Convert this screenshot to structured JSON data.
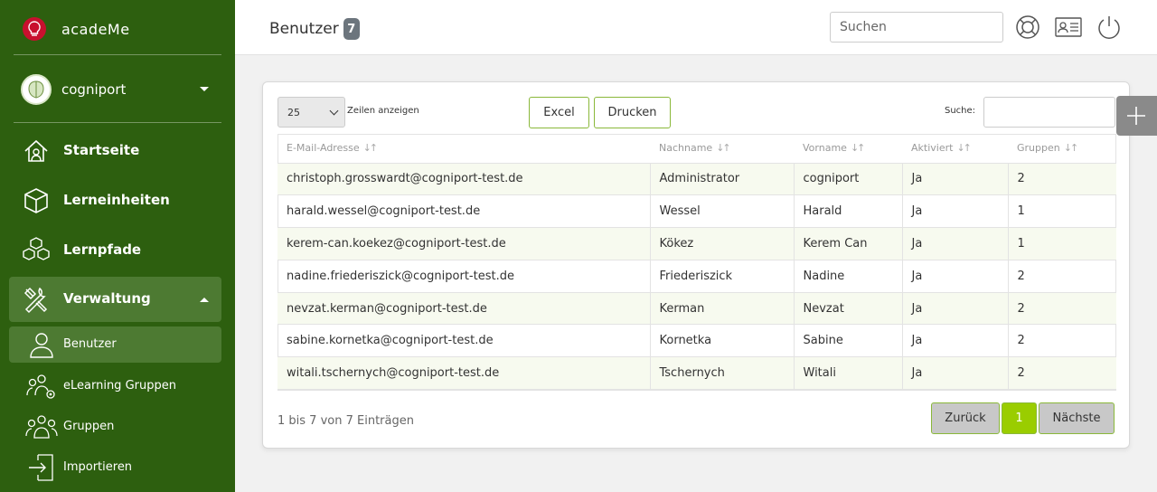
{
  "app": {
    "name": "acadeMe"
  },
  "org": {
    "name": "cogniport"
  },
  "nav": [
    {
      "label": "Startseite",
      "icon": "home-icon"
    },
    {
      "label": "Lerneinheiten",
      "icon": "cube-icon"
    },
    {
      "label": "Lernpfade",
      "icon": "cubes-icon"
    },
    {
      "label": "Verwaltung",
      "icon": "tools-icon"
    }
  ],
  "subnav": [
    {
      "label": "Benutzer",
      "icon": "user-icon"
    },
    {
      "label": "eLearning Gruppen",
      "icon": "group-settings-icon"
    },
    {
      "label": "Gruppen",
      "icon": "group-icon"
    },
    {
      "label": "Importieren",
      "icon": "import-icon"
    }
  ],
  "header": {
    "title": "Benutzer",
    "count": "7",
    "search_placeholder": "Suchen"
  },
  "toolbar": {
    "page_size": "25",
    "rows_label": "Zeilen anzeigen",
    "excel": "Excel",
    "print": "Drucken",
    "search_label": "Suche:"
  },
  "table": {
    "columns": [
      "E-Mail-Adresse",
      "Nachname",
      "Vorname",
      "Aktiviert",
      "Gruppen"
    ],
    "rows": [
      [
        "christoph.grosswardt@cogniport-test.de",
        "Administrator",
        "cogniport",
        "Ja",
        "2"
      ],
      [
        "harald.wessel@cogniport-test.de",
        "Wessel",
        "Harald",
        "Ja",
        "1"
      ],
      [
        "kerem-can.koekez@cogniport-test.de",
        "Kökez",
        "Kerem Can",
        "Ja",
        "1"
      ],
      [
        "nadine.friederiszick@cogniport-test.de",
        "Friederiszick",
        "Nadine",
        "Ja",
        "2"
      ],
      [
        "nevzat.kerman@cogniport-test.de",
        "Kerman",
        "Nevzat",
        "Ja",
        "2"
      ],
      [
        "sabine.kornetka@cogniport-test.de",
        "Kornetka",
        "Sabine",
        "Ja",
        "2"
      ],
      [
        "witali.tschernych@cogniport-test.de",
        "Tschernych",
        "Witali",
        "Ja",
        "2"
      ]
    ]
  },
  "pagination": {
    "info": "1 bis 7 von 7 Einträgen",
    "prev": "Zurück",
    "current": "1",
    "next": "Nächste"
  },
  "colors": {
    "sidebar": "#2d5f0f",
    "sidebar_active": "#4d7a32",
    "accent": "#9acd00",
    "border_accent": "#8ab83a"
  }
}
